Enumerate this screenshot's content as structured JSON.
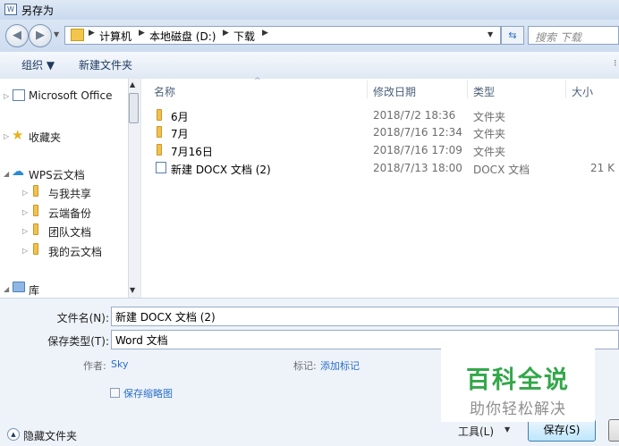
{
  "window": {
    "title": "另存为"
  },
  "address": {
    "crumbs": [
      "计算机",
      "本地磁盘 (D:)",
      "下载"
    ],
    "search_placeholder": "搜索 下载"
  },
  "toolbar": {
    "organize_label": "组织 ▼",
    "new_folder_label": "新建文件夹"
  },
  "nav": {
    "items": [
      {
        "label": "Microsoft Office"
      },
      {
        "label": "收藏夹"
      },
      {
        "label": "WPS云文档"
      },
      {
        "label": "与我共享"
      },
      {
        "label": "云端备份"
      },
      {
        "label": "团队文档"
      },
      {
        "label": "我的云文档"
      },
      {
        "label": "库"
      }
    ]
  },
  "columns": {
    "name": "名称",
    "modified": "修改日期",
    "type": "类型",
    "size": "大小"
  },
  "files": [
    {
      "name": "6月",
      "modified": "2018/7/2 18:36",
      "type": "文件夹",
      "size": ""
    },
    {
      "name": "7月",
      "modified": "2018/7/16 12:34",
      "type": "文件夹",
      "size": ""
    },
    {
      "name": "7月16日",
      "modified": "2018/7/16 17:09",
      "type": "文件夹",
      "size": ""
    },
    {
      "name": "新建 DOCX 文档 (2)",
      "modified": "2018/7/13 18:00",
      "type": "DOCX 文档",
      "size": "21 K"
    }
  ],
  "form": {
    "filename_label": "文件名(N):",
    "filename_value": "新建 DOCX 文档 (2)",
    "filetype_label": "保存类型(T):",
    "filetype_value": "Word 文档",
    "author_label": "作者:",
    "author_value": "Sky",
    "tags_label": "标记:",
    "tags_value": "添加标记",
    "thumbnail_label": "保存缩略图"
  },
  "footer": {
    "hide_folders_label": "隐藏文件夹",
    "tools_label": "工具(L)",
    "save_label": "保存(S)"
  },
  "watermark": {
    "title": "百科全说",
    "subtitle": "助你轻松解决"
  },
  "colors": {
    "accent": "#2a6fc9",
    "folder": "#f2c14e",
    "watermark_green": "#33a74a"
  }
}
